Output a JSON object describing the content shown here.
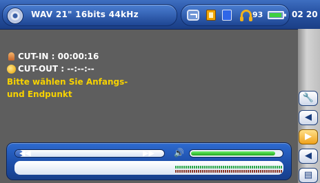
{
  "header": {
    "file_info": "WAV 21\" 16bits 44kHz",
    "volume": "93",
    "time": "02 20"
  },
  "main": {
    "cut_in": "CUT-IN : 00:00:16",
    "cut_out": "CUT-OUT : --:--:--",
    "hint_line1": "Bitte wählen Sie Anfangs-",
    "hint_line2": "und Endpunkt"
  },
  "sidebar": {
    "buttons": [
      {
        "icon": "wrench-icon",
        "glyph": "🔧"
      },
      {
        "icon": "speaker-icon",
        "glyph": "◀"
      },
      {
        "icon": "play-icon",
        "glyph": "▶"
      },
      {
        "icon": "back-icon",
        "glyph": "◀"
      },
      {
        "icon": "menu-icon",
        "glyph": "▤"
      }
    ]
  },
  "player": {
    "position_fraction": 0.05,
    "volume_fraction": 0.93,
    "rewind_glyph": "◀◀",
    "forward_glyph": "▶▶",
    "speaker_glyph": "🔊"
  },
  "colors": {
    "accent": "#2752a3",
    "hint": "#f7d200",
    "active_button": "#f0a21c",
    "volume_fill": "#1fa51d"
  }
}
